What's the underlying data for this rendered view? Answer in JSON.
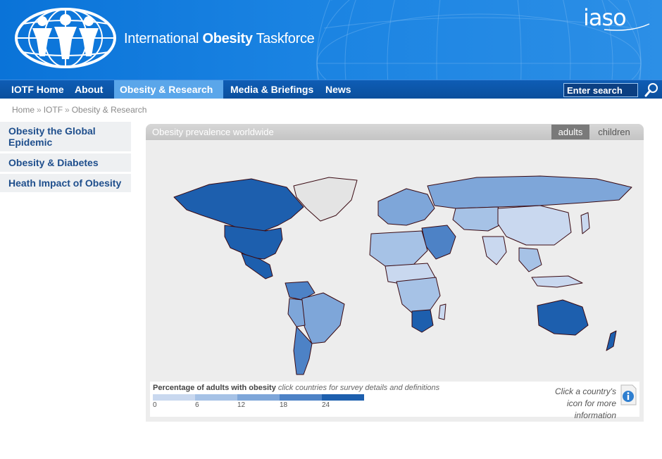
{
  "header": {
    "org_name_prefix": "International ",
    "org_name_bold": "Obesity",
    "org_name_suffix": " Taskforce",
    "partner_logo": "iaso",
    "colors": {
      "header_blue": "#0a73d8",
      "nav_blue": "#0e5db5",
      "nav_active": "#5aa6ea"
    }
  },
  "nav": {
    "items": [
      {
        "label": "IOTF Home"
      },
      {
        "label": "About"
      },
      {
        "label": "Obesity & Research",
        "active": true
      },
      {
        "label": "Media & Briefings"
      },
      {
        "label": "News"
      }
    ],
    "search_value": "Enter search",
    "search_icon": "magnifier-icon"
  },
  "breadcrumb": [
    "Home",
    "IOTF",
    "Obesity & Research"
  ],
  "sidebar": {
    "items": [
      {
        "label": "Obesity the Global Epidemic"
      },
      {
        "label": "Obesity & Diabetes"
      },
      {
        "label": "Heath Impact of Obesity"
      }
    ]
  },
  "map_panel": {
    "title": "Obesity prevalence worldwide",
    "toggle": {
      "adults": "adults",
      "children": "children",
      "selected": "adults"
    },
    "legend": {
      "title_bold": "Percentage of adults with obesity",
      "title_italic": " click countries for survey details and definitions",
      "ticks": [
        "0",
        "6",
        "12",
        "18",
        "24"
      ],
      "colors": [
        "#c9d8ef",
        "#a6c2e6",
        "#7ea6d9",
        "#4d82c6",
        "#1d5fae"
      ]
    },
    "info_text": "Click a country's icon for more information",
    "info_icon": "info-icon"
  }
}
